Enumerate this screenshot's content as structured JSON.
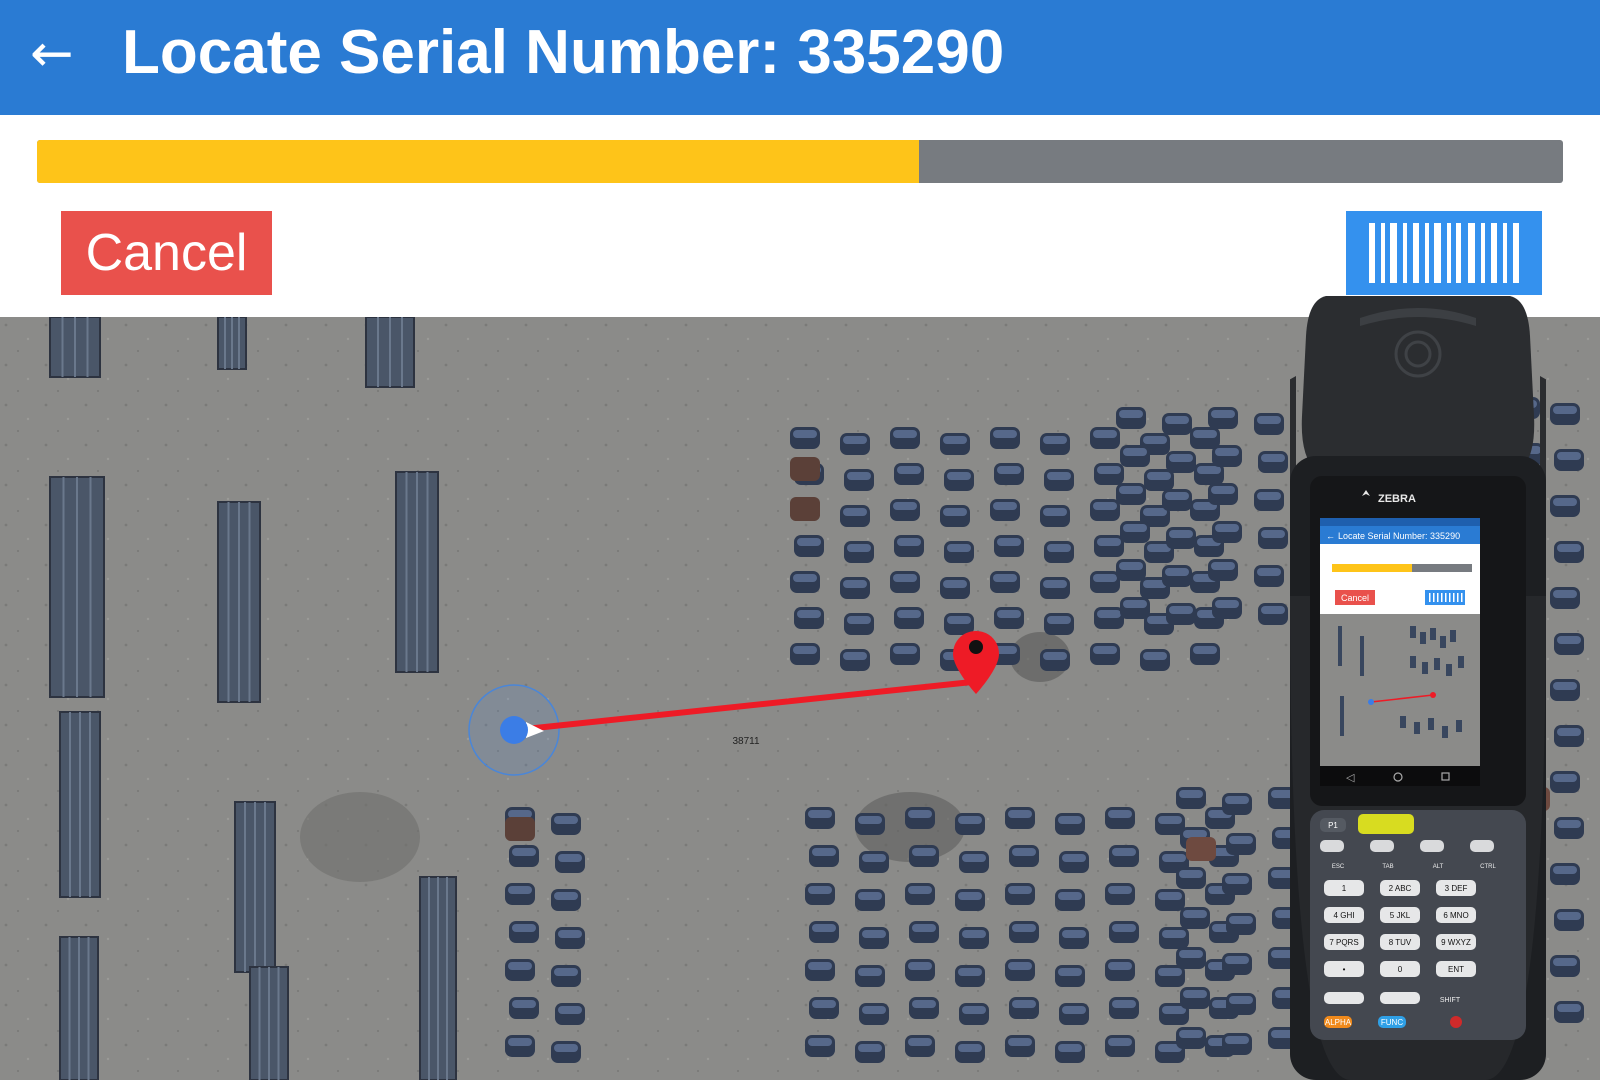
{
  "header": {
    "back_glyph": "←",
    "title": "Locate Serial Number: 335290"
  },
  "progress": {
    "fraction": 0.578
  },
  "actions": {
    "cancel_label": "Cancel"
  },
  "map": {
    "plot_label": "38711"
  },
  "device": {
    "brand": "ZEBRA",
    "screen": {
      "title": "Locate Serial Number: 335290",
      "cancel_label": "Cancel"
    },
    "keypad": {
      "top_keys": [
        "P1"
      ],
      "function_row": [
        "ESC",
        "TAB",
        "ALT",
        "CTRL"
      ],
      "digits": [
        [
          "1",
          ""
        ],
        [
          "2",
          "ABC"
        ],
        [
          "3",
          "DEF"
        ],
        [
          "4",
          "GHI"
        ],
        [
          "5",
          "JKL"
        ],
        [
          "6",
          "MNO"
        ],
        [
          "7",
          "PQRS"
        ],
        [
          "8",
          "TUV"
        ],
        [
          "9",
          "WXYZ"
        ],
        [
          "•",
          ""
        ],
        [
          "0",
          ""
        ],
        [
          "ENT",
          ""
        ]
      ],
      "bottom_row": [
        "SHIFT"
      ],
      "mode_keys": [
        "ALPHA",
        "FUNC"
      ]
    }
  },
  "colors": {
    "appbar": "#2a7bd3",
    "progress_fill": "#fec419",
    "progress_track": "#777b80",
    "cancel": "#e9514c",
    "scan": "#3491ee",
    "route": "#ee1b26",
    "user_dot": "#3b7de6"
  }
}
